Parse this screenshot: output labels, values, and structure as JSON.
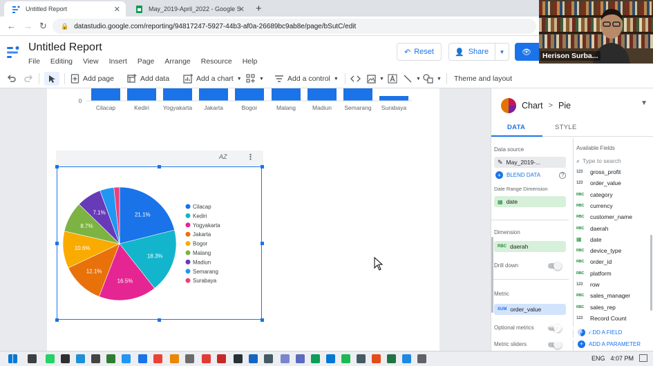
{
  "browser": {
    "tabs": [
      {
        "title": "Untitled Report",
        "active": true
      },
      {
        "title": "May_2019-April_2022 - Google S",
        "active": false
      }
    ],
    "url": "datastudio.google.com/reporting/94817247-5927-44b3-af0a-26689bc9ab8e/page/bSutC/edit"
  },
  "app": {
    "title": "Untitled Report",
    "menu": [
      "File",
      "Editing",
      "View",
      "Insert",
      "Page",
      "Arrange",
      "Resource",
      "Help"
    ],
    "reset_label": "Reset",
    "share_label": "Share"
  },
  "webcam": {
    "name": "Herison Surba..."
  },
  "toolbar": {
    "add_page": "Add page",
    "add_data": "Add data",
    "add_chart": "Add a chart",
    "add_control": "Add a control",
    "theme": "Theme and layout"
  },
  "canvas": {
    "bar_chart": {
      "zero_label": "0",
      "categories": [
        "Cilacap",
        "Kediri",
        "Yogyakarta",
        "Jakarta",
        "Bogor",
        "Malang",
        "Madiun",
        "Semarang",
        "Surabaya"
      ]
    },
    "pie_sort_label": "AZ"
  },
  "chart_data": {
    "type": "pie",
    "title": "",
    "legend_position": "right",
    "labels": [
      "Cilacap",
      "Kediri",
      "Yogyakarta",
      "Jakarta",
      "Bogor",
      "Malang",
      "Madiun",
      "Semarang",
      "Surabaya"
    ],
    "values": [
      21.1,
      18.3,
      16.5,
      12.1,
      10.6,
      8.7,
      7.1,
      4.0,
      1.6
    ],
    "value_labels": [
      "21.1%",
      "18.3%",
      "16.5%",
      "12.1%",
      "10.6%",
      "8.7%",
      "7.1%",
      "",
      ""
    ],
    "colors": [
      "#1a73e8",
      "#12b5cb",
      "#e52592",
      "#e8710a",
      "#f9ab00",
      "#7cb342",
      "#673ab7",
      "#2196f3",
      "#ec407a"
    ]
  },
  "panel": {
    "chart_label": "Chart",
    "chart_type": "Pie",
    "tabs": [
      "DATA",
      "STYLE"
    ],
    "data_source_label": "Data source",
    "data_source": "May_2019-...",
    "blend_label": "BLEND DATA",
    "date_range_label": "Date Range Dimension",
    "date_field": "date",
    "dimension_label": "Dimension",
    "dimension_tag": "RBC",
    "dimension_field": "daerah",
    "drill_down_label": "Drill down",
    "metric_label": "Metric",
    "metric_tag": "SUM",
    "metric_field": "order_value",
    "optional_metrics_label": "Optional metrics",
    "metric_sliders_label": "Metric sliders",
    "available_fields_label": "Available Fields",
    "search_placeholder": "Type to search",
    "fields": [
      {
        "type": "123",
        "name": "gross_profit"
      },
      {
        "type": "123",
        "name": "order_value"
      },
      {
        "type": "RBC",
        "name": "category"
      },
      {
        "type": "RBC",
        "name": "currency"
      },
      {
        "type": "RBC",
        "name": "customer_name"
      },
      {
        "type": "RBC",
        "name": "daerah"
      },
      {
        "type": "date",
        "name": "date"
      },
      {
        "type": "RBC",
        "name": "device_type"
      },
      {
        "type": "RBC",
        "name": "order_id"
      },
      {
        "type": "RBC",
        "name": "platform"
      },
      {
        "type": "123",
        "name": "row"
      },
      {
        "type": "RBC",
        "name": "sales_manager"
      },
      {
        "type": "RBC",
        "name": "sales_rep"
      },
      {
        "type": "123",
        "name": "Record Count"
      }
    ],
    "add_field": "ADD A FIELD",
    "add_parameter": "ADD A PARAMETER"
  },
  "taskbar": {
    "lang": "ENG",
    "time": "4:07 PM"
  },
  "colors": {
    "accent": "#1a73e8",
    "bar": "#1a73e8"
  }
}
